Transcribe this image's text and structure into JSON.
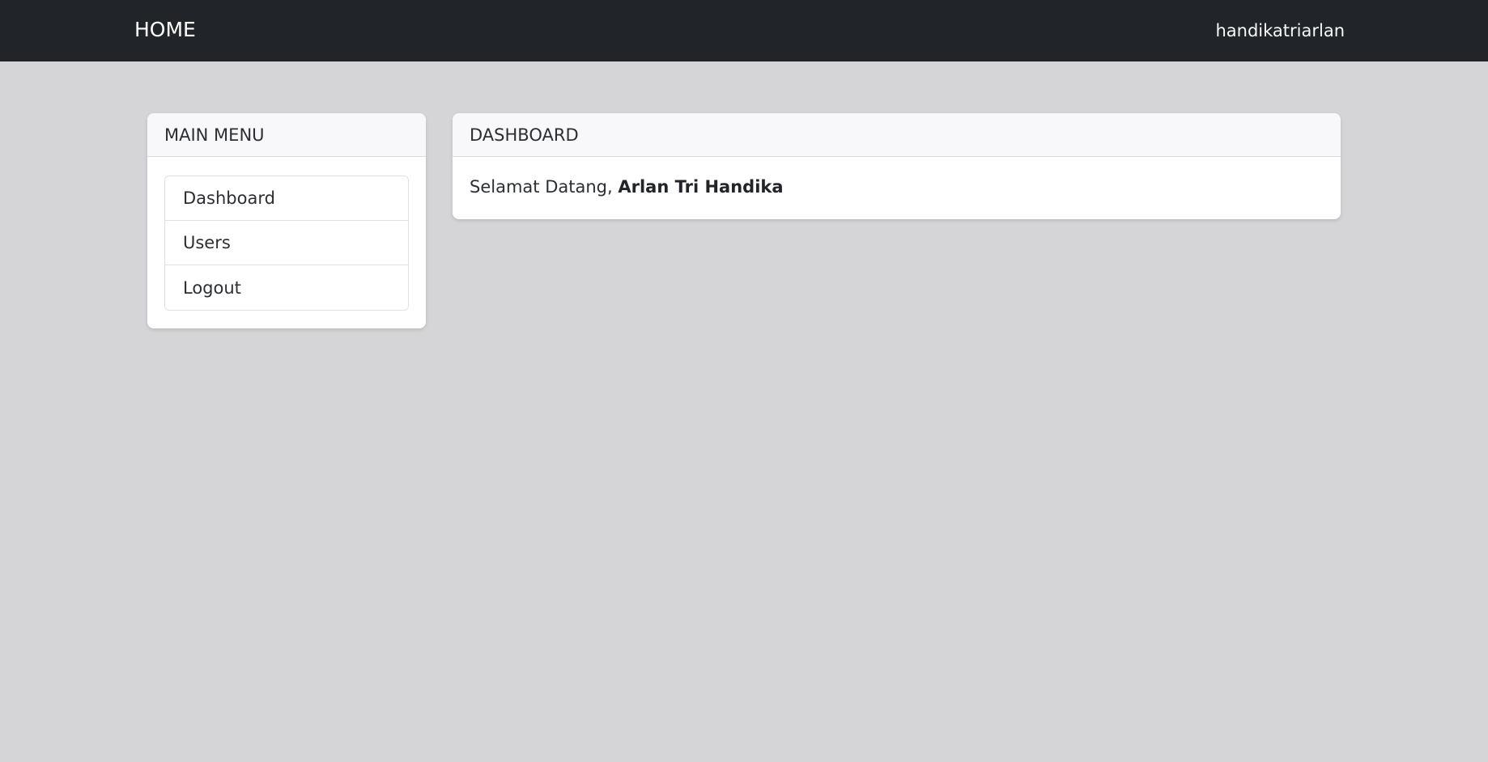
{
  "navbar": {
    "brand": "HOME",
    "username": "handikatriarlan",
    "background": "#212529"
  },
  "menu": {
    "title": "MAIN MENU",
    "items": [
      {
        "label": "Dashboard"
      },
      {
        "label": "Users"
      },
      {
        "label": "Logout"
      }
    ]
  },
  "dashboard": {
    "title": "DASHBOARD",
    "greeting": "Selamat Datang,",
    "user_fullname": "Arlan Tri Handika"
  },
  "colors": {
    "page_background": "#d5d4d7",
    "card_background": "#ffffff"
  }
}
